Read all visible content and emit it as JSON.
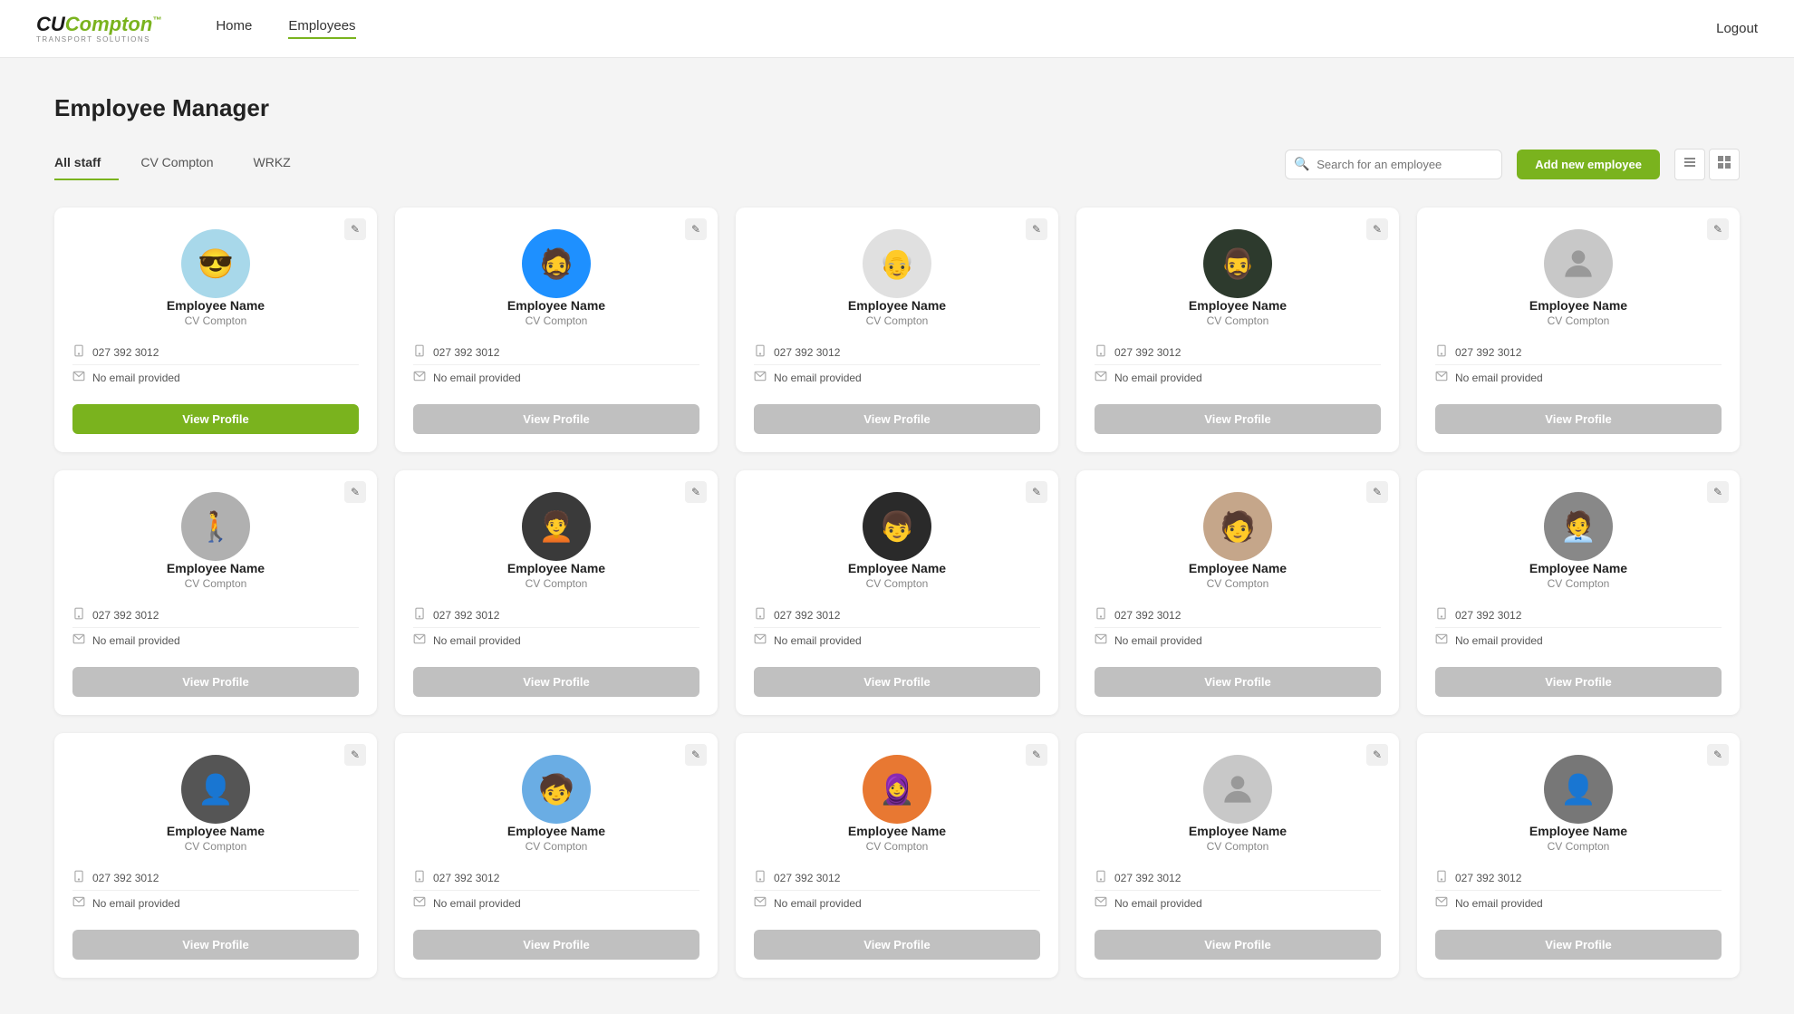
{
  "brand": {
    "name": "CUCompton",
    "name_styled": "CUCompton",
    "sub": "TRANSPORT SOLUTIONS"
  },
  "nav": {
    "home": "Home",
    "employees": "Employees",
    "logout": "Logout"
  },
  "page": {
    "title": "Employee Manager"
  },
  "tabs": [
    {
      "id": "all-staff",
      "label": "All staff",
      "active": true
    },
    {
      "id": "cv-compton",
      "label": "CV Compton",
      "active": false
    },
    {
      "id": "wrkz",
      "label": "WRKZ",
      "active": false
    }
  ],
  "search": {
    "placeholder": "Search for an employee"
  },
  "toolbar": {
    "add_label": "Add new employee"
  },
  "employees": [
    {
      "id": 1,
      "name": "Employee Name",
      "company": "CV Compton",
      "phone": "027 392 3012",
      "email": "No email provided",
      "highlighted": true,
      "avatar_color": "#87CEEB",
      "avatar_type": "photo1"
    },
    {
      "id": 2,
      "name": "Employee Name",
      "company": "CV Compton",
      "phone": "027 392 3012",
      "email": "No email provided",
      "highlighted": false,
      "avatar_color": "#1E90FF",
      "avatar_type": "photo2"
    },
    {
      "id": 3,
      "name": "Employee Name",
      "company": "CV Compton",
      "phone": "027 392 3012",
      "email": "No email provided",
      "highlighted": false,
      "avatar_color": "#ddd",
      "avatar_type": "photo3"
    },
    {
      "id": 4,
      "name": "Employee Name",
      "company": "CV Compton",
      "phone": "027 392 3012",
      "email": "No email provided",
      "highlighted": false,
      "avatar_color": "#2d2d2d",
      "avatar_type": "photo4"
    },
    {
      "id": 5,
      "name": "Employee Name",
      "company": "CV Compton",
      "phone": "027 392 3012",
      "email": "No email provided",
      "highlighted": false,
      "avatar_color": "#c0c0c0",
      "avatar_type": "placeholder"
    },
    {
      "id": 6,
      "name": "Employee Name",
      "company": "CV Compton",
      "phone": "027 392 3012",
      "email": "No email provided",
      "highlighted": false,
      "avatar_color": "#ccc",
      "avatar_type": "photo5"
    },
    {
      "id": 7,
      "name": "Employee Name",
      "company": "CV Compton",
      "phone": "027 392 3012",
      "email": "No email provided",
      "highlighted": false,
      "avatar_color": "#333",
      "avatar_type": "photo6"
    },
    {
      "id": 8,
      "name": "Employee Name",
      "company": "CV Compton",
      "phone": "027 392 3012",
      "email": "No email provided",
      "highlighted": false,
      "avatar_color": "#222",
      "avatar_type": "photo7"
    },
    {
      "id": 9,
      "name": "Employee Name",
      "company": "CV Compton",
      "phone": "027 392 3012",
      "email": "No email provided",
      "highlighted": false,
      "avatar_color": "#b8a090",
      "avatar_type": "photo8"
    },
    {
      "id": 10,
      "name": "Employee Name",
      "company": "CV Compton",
      "phone": "027 392 3012",
      "email": "No email provided",
      "highlighted": false,
      "avatar_color": "#888",
      "avatar_type": "photo9"
    },
    {
      "id": 11,
      "name": "Employee Name",
      "company": "CV Compton",
      "phone": "027 392 3012",
      "email": "No email provided",
      "highlighted": false,
      "avatar_color": "#555",
      "avatar_type": "photo10"
    },
    {
      "id": 12,
      "name": "Employee Name",
      "company": "CV Compton",
      "phone": "027 392 3012",
      "email": "No email provided",
      "highlighted": false,
      "avatar_color": "#4a90d9",
      "avatar_type": "photo11"
    },
    {
      "id": 13,
      "name": "Employee Name",
      "company": "CV Compton",
      "phone": "027 392 3012",
      "email": "No email provided",
      "highlighted": false,
      "avatar_color": "#e87832",
      "avatar_type": "photo12"
    },
    {
      "id": 14,
      "name": "Employee Name",
      "company": "CV Compton",
      "phone": "027 392 3012",
      "email": "No email provided",
      "highlighted": false,
      "avatar_color": "#aaa",
      "avatar_type": "placeholder"
    },
    {
      "id": 15,
      "name": "Employee Name",
      "company": "CV Compton",
      "phone": "027 392 3012",
      "email": "No email provided",
      "highlighted": false,
      "avatar_color": "#666",
      "avatar_type": "photo13"
    }
  ],
  "labels": {
    "view_profile": "View Profile",
    "edit_icon": "✎",
    "phone_icon": "📱",
    "email_icon": "✉"
  },
  "colors": {
    "green": "#7ab31e",
    "gray_btn": "#c0c0c0",
    "active_tab_underline": "#7ab31e"
  }
}
